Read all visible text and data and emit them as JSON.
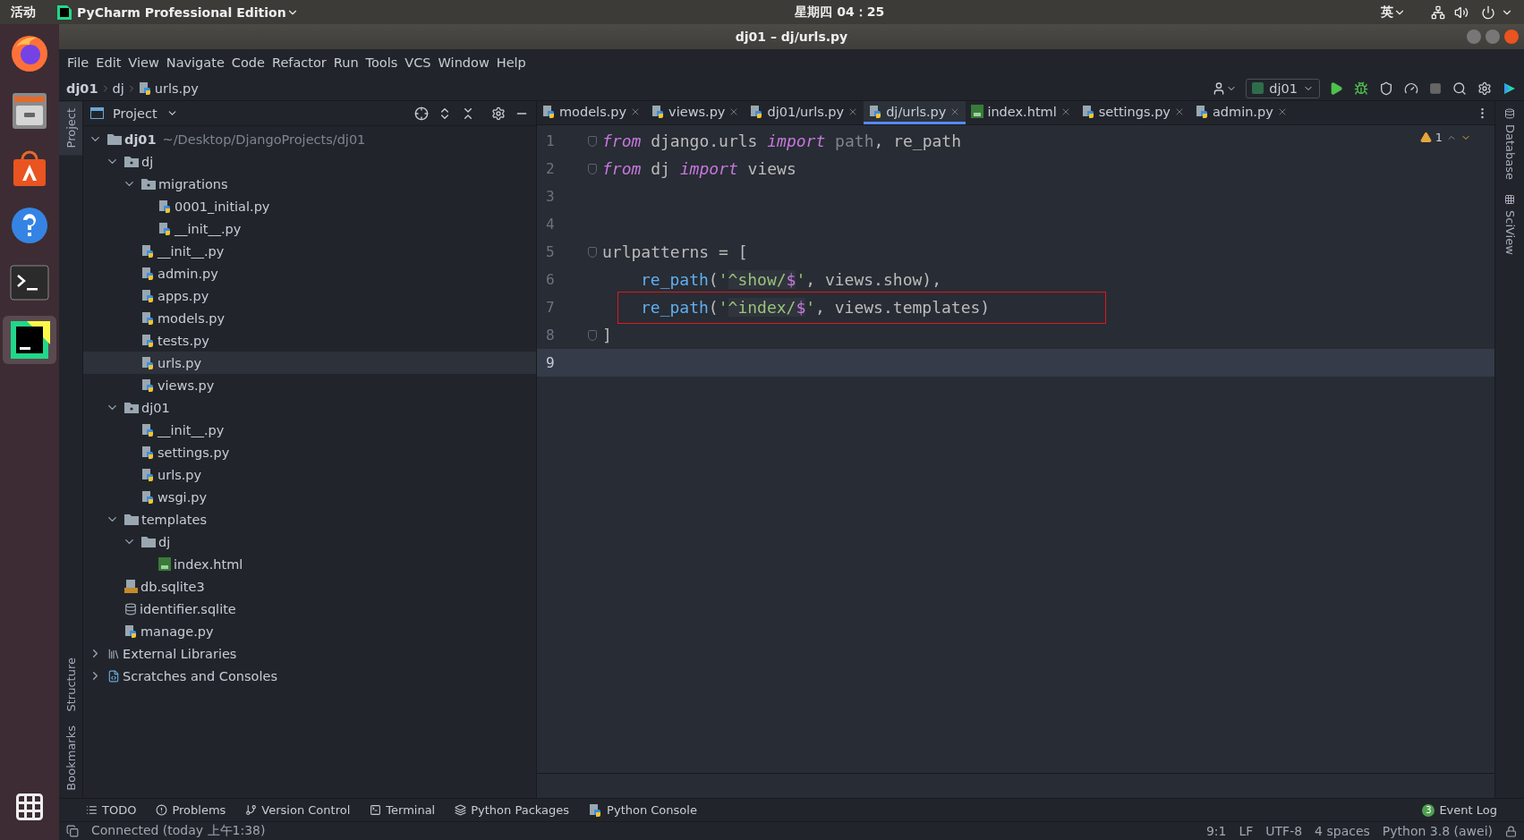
{
  "top_bar": {
    "activities": "活动",
    "app_menu": "PyCharm Professional Edition",
    "clock": "星期四 04：25",
    "input_method": "英"
  },
  "dock": [
    {
      "kind": "firefox",
      "selected": false
    },
    {
      "kind": "files",
      "selected": false
    },
    {
      "kind": "software",
      "selected": false
    },
    {
      "kind": "help",
      "selected": false
    },
    {
      "kind": "terminal",
      "selected": false
    },
    {
      "kind": "pycharm",
      "selected": true
    },
    {
      "kind": "apps",
      "selected": false
    }
  ],
  "window": {
    "title": "dj01 – dj/urls.py"
  },
  "menu": [
    "File",
    "Edit",
    "View",
    "Navigate",
    "Code",
    "Refactor",
    "Run",
    "Tools",
    "VCS",
    "Window",
    "Help"
  ],
  "breadcrumb": [
    {
      "label": "dj01",
      "kind": "project"
    },
    {
      "label": "dj",
      "kind": "folder"
    },
    {
      "label": "urls.py",
      "kind": "python"
    }
  ],
  "run_config": {
    "label": "dj01"
  },
  "left_strip": {
    "top": [
      {
        "label": "Project",
        "selected": true
      }
    ],
    "bottom": [
      {
        "label": "Structure",
        "selected": false
      },
      {
        "label": "Bookmarks",
        "selected": false
      }
    ]
  },
  "project_panel": {
    "title": "Project",
    "tree": [
      {
        "label": "dj01",
        "hint": "~/Desktop/DjangoProjects/dj01",
        "kind": "folder",
        "expanded": true,
        "selected": false,
        "children": [
          {
            "label": "dj",
            "kind": "package",
            "expanded": true,
            "selected": false,
            "children": [
              {
                "label": "migrations",
                "kind": "package",
                "expanded": true,
                "selected": false,
                "children": [
                  {
                    "label": "0001_initial.py",
                    "kind": "python",
                    "selected": false
                  },
                  {
                    "label": "__init__.py",
                    "kind": "python",
                    "selected": false
                  }
                ]
              },
              {
                "label": "__init__.py",
                "kind": "python",
                "selected": false
              },
              {
                "label": "admin.py",
                "kind": "python",
                "selected": false
              },
              {
                "label": "apps.py",
                "kind": "python",
                "selected": false
              },
              {
                "label": "models.py",
                "kind": "python",
                "selected": false
              },
              {
                "label": "tests.py",
                "kind": "python",
                "selected": false
              },
              {
                "label": "urls.py",
                "kind": "python",
                "selected": true
              },
              {
                "label": "views.py",
                "kind": "python",
                "selected": false
              }
            ]
          },
          {
            "label": "dj01",
            "kind": "package",
            "expanded": true,
            "selected": false,
            "children": [
              {
                "label": "__init__.py",
                "kind": "python",
                "selected": false
              },
              {
                "label": "settings.py",
                "kind": "python",
                "selected": false
              },
              {
                "label": "urls.py",
                "kind": "python",
                "selected": false
              },
              {
                "label": "wsgi.py",
                "kind": "python",
                "selected": false
              }
            ]
          },
          {
            "label": "templates",
            "kind": "folder",
            "expanded": true,
            "selected": false,
            "children": [
              {
                "label": "dj",
                "kind": "folder",
                "expanded": true,
                "selected": false,
                "children": [
                  {
                    "label": "index.html",
                    "kind": "html",
                    "selected": false
                  }
                ]
              }
            ]
          },
          {
            "label": "db.sqlite3",
            "kind": "sqlite",
            "selected": false
          },
          {
            "label": "identifier.sqlite",
            "kind": "database",
            "selected": false
          },
          {
            "label": "manage.py",
            "kind": "python",
            "selected": false
          }
        ]
      },
      {
        "label": "External Libraries",
        "kind": "libraries",
        "expanded": false,
        "selected": false
      },
      {
        "label": "Scratches and Consoles",
        "kind": "scratches",
        "expanded": false,
        "selected": false
      }
    ]
  },
  "tabs": [
    {
      "label": "models.py",
      "kind": "python",
      "selected": false
    },
    {
      "label": "views.py",
      "kind": "python",
      "selected": false
    },
    {
      "label": "dj01/urls.py",
      "kind": "python",
      "selected": false
    },
    {
      "label": "dj/urls.py",
      "kind": "python",
      "selected": true
    },
    {
      "label": "index.html",
      "kind": "html",
      "selected": false
    },
    {
      "label": "settings.py",
      "kind": "python",
      "selected": false
    },
    {
      "label": "admin.py",
      "kind": "python",
      "selected": false
    }
  ],
  "editor": {
    "warning_count": "1",
    "lines": [
      {
        "number": "1",
        "fold": true,
        "current": false,
        "boxed": false,
        "indented": false,
        "tokens": [
          {
            "text": "from",
            "kind": "keyword"
          },
          {
            "text": " django.urls ",
            "kind": "plain"
          },
          {
            "text": "import",
            "kind": "keyword"
          },
          {
            "text": " path",
            "kind": "unused"
          },
          {
            "text": ", re_path",
            "kind": "plain"
          }
        ]
      },
      {
        "number": "2",
        "fold": true,
        "current": false,
        "boxed": false,
        "indented": false,
        "tokens": [
          {
            "text": "from",
            "kind": "keyword"
          },
          {
            "text": " dj ",
            "kind": "plain"
          },
          {
            "text": "import",
            "kind": "keyword"
          },
          {
            "text": " views",
            "kind": "plain"
          }
        ]
      },
      {
        "number": "3",
        "fold": false,
        "current": false,
        "boxed": false,
        "indented": false
      },
      {
        "number": "4",
        "fold": false,
        "current": false,
        "boxed": false,
        "indented": false
      },
      {
        "number": "5",
        "fold": true,
        "current": false,
        "boxed": false,
        "indented": false,
        "tokens": [
          {
            "text": "urlpatterns = [",
            "kind": "plain"
          }
        ]
      },
      {
        "number": "6",
        "fold": false,
        "current": false,
        "boxed": false,
        "indented": true,
        "tokens": [
          {
            "text": "re_path",
            "kind": "call"
          },
          {
            "text": "(",
            "kind": "plain"
          },
          {
            "text": "'",
            "kind": "string"
          },
          {
            "text": "^show/",
            "kind": "regex"
          },
          {
            "text": "$",
            "kind": "regex-meta"
          },
          {
            "text": "'",
            "kind": "string"
          },
          {
            "text": ", views.show),",
            "kind": "plain"
          }
        ]
      },
      {
        "number": "7",
        "fold": false,
        "current": false,
        "boxed": true,
        "indented": true,
        "tokens": [
          {
            "text": "re_path",
            "kind": "call"
          },
          {
            "text": "(",
            "kind": "plain"
          },
          {
            "text": "'",
            "kind": "string"
          },
          {
            "text": "^index/",
            "kind": "regex"
          },
          {
            "text": "$",
            "kind": "regex-meta"
          },
          {
            "text": "'",
            "kind": "string"
          },
          {
            "text": ", views.templates)",
            "kind": "plain"
          }
        ]
      },
      {
        "number": "8",
        "fold": true,
        "current": false,
        "boxed": false,
        "indented": false,
        "tokens": [
          {
            "text": "]",
            "kind": "plain"
          }
        ]
      },
      {
        "number": "9",
        "fold": false,
        "current": true,
        "boxed": false,
        "indented": false
      }
    ]
  },
  "right_strip": [
    {
      "label": "Database",
      "kind": "database"
    },
    {
      "label": "SciView",
      "kind": "sciview"
    }
  ],
  "tool_windows": [
    {
      "label": "TODO",
      "kind": "todo"
    },
    {
      "label": "Problems",
      "kind": "problems"
    },
    {
      "label": "Version Control",
      "kind": "vcs"
    },
    {
      "label": "Terminal",
      "kind": "terminal"
    },
    {
      "label": "Python Packages",
      "kind": "packages"
    },
    {
      "label": "Python Console",
      "kind": "console"
    }
  ],
  "event_log": {
    "count": "3",
    "label": "Event Log"
  },
  "status_bar": {
    "message": "Connected (today 上午1:38)",
    "items": [
      "9:1",
      "LF",
      "UTF-8",
      "4 spaces",
      "Python 3.8 (awei)"
    ]
  }
}
